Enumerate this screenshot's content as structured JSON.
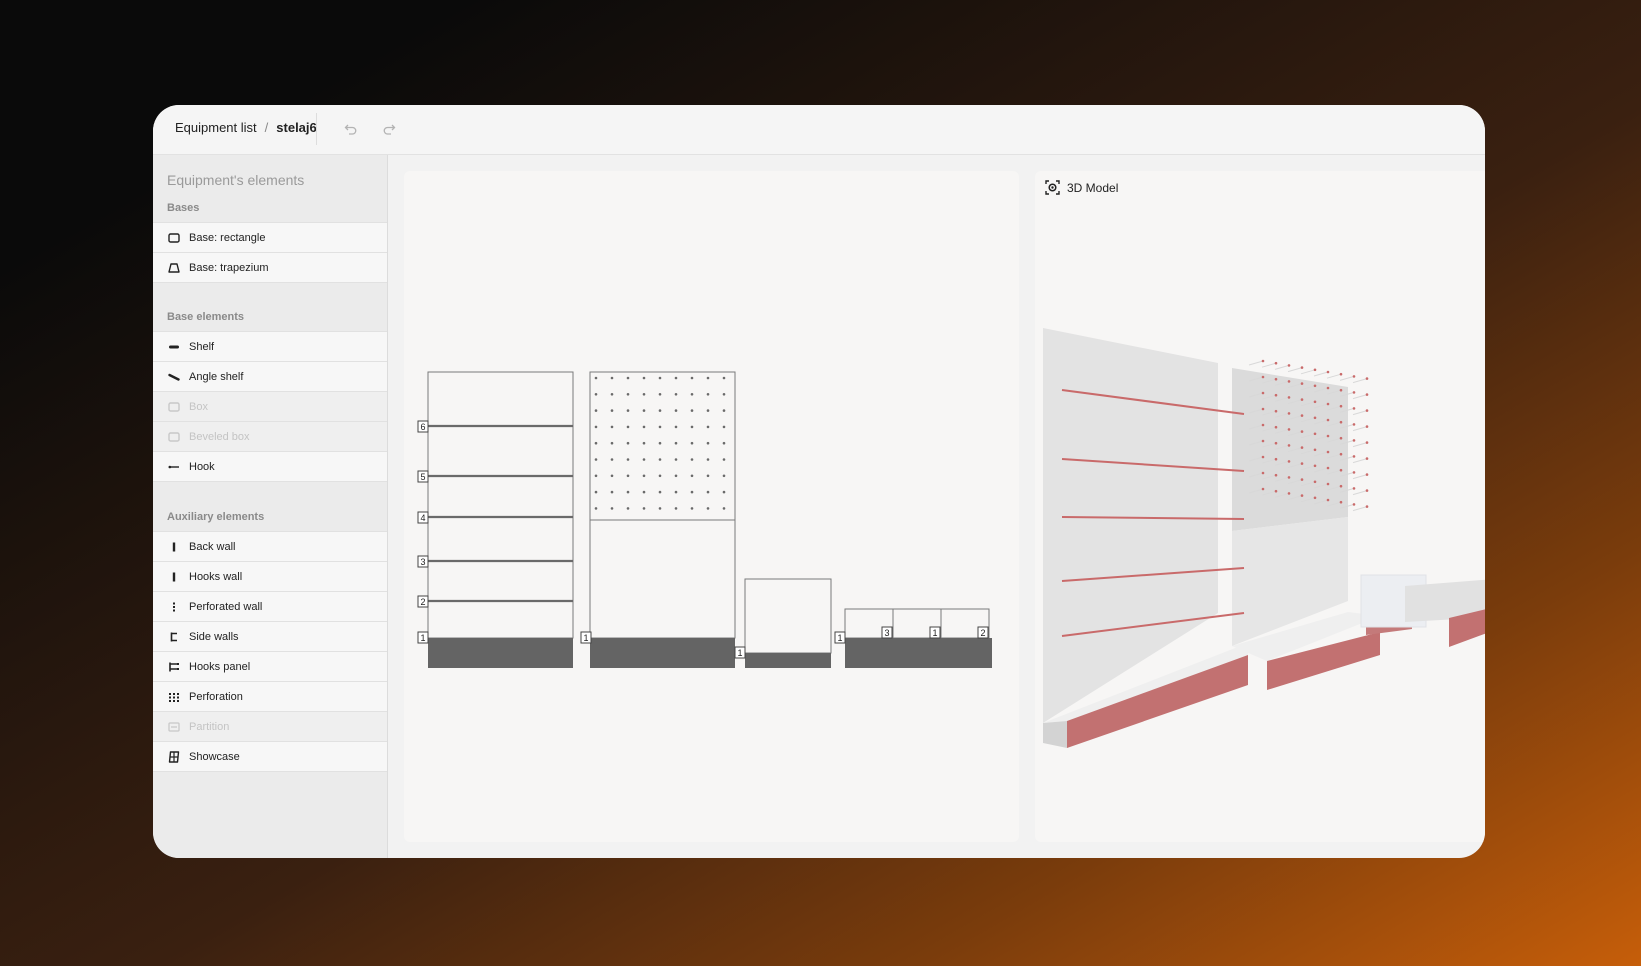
{
  "breadcrumb": {
    "root": "Equipment list",
    "separator": "/",
    "current": "stelaj6"
  },
  "toolbar": {
    "undo_icon": "undo-icon",
    "redo_icon": "redo-icon"
  },
  "sidebar": {
    "title": "Equipment's elements",
    "sections": [
      {
        "label": "Bases",
        "items": [
          {
            "label": "Base: rectangle",
            "icon": "rectangle-icon",
            "disabled": false
          },
          {
            "label": "Base: trapezium",
            "icon": "trapezium-icon",
            "disabled": false
          }
        ]
      },
      {
        "label": "Base elements",
        "items": [
          {
            "label": "Shelf",
            "icon": "shelf-icon",
            "disabled": false
          },
          {
            "label": "Angle shelf",
            "icon": "angle-shelf-icon",
            "disabled": false
          },
          {
            "label": "Box",
            "icon": "box-icon",
            "disabled": true
          },
          {
            "label": "Beveled box",
            "icon": "beveled-box-icon",
            "disabled": true
          },
          {
            "label": "Hook",
            "icon": "hook-icon",
            "disabled": false
          }
        ]
      },
      {
        "label": "Auxiliary elements",
        "items": [
          {
            "label": "Back wall",
            "icon": "back-wall-icon",
            "disabled": false
          },
          {
            "label": "Hooks wall",
            "icon": "hooks-wall-icon",
            "disabled": false
          },
          {
            "label": "Perforated wall",
            "icon": "perforated-wall-icon",
            "disabled": false
          },
          {
            "label": "Side walls",
            "icon": "side-walls-icon",
            "disabled": false
          },
          {
            "label": "Hooks panel",
            "icon": "hooks-panel-icon",
            "disabled": false
          },
          {
            "label": "Perforation",
            "icon": "perforation-icon",
            "disabled": false
          },
          {
            "label": "Partition",
            "icon": "partition-icon",
            "disabled": true
          },
          {
            "label": "Showcase",
            "icon": "showcase-icon",
            "disabled": false
          }
        ]
      }
    ]
  },
  "editor": {
    "unit_a_labels": [
      "6",
      "5",
      "4",
      "3",
      "2",
      "1"
    ],
    "unit_b_labels": [
      "1"
    ],
    "unit_c_labels": [
      "1"
    ],
    "unit_d_labels": [
      "1",
      "3",
      "1",
      "2"
    ]
  },
  "model_panel": {
    "title": "3D Model",
    "icon": "3d-model-icon"
  },
  "colors": {
    "accent": "#c96a6a",
    "base_fill": "#646464"
  }
}
